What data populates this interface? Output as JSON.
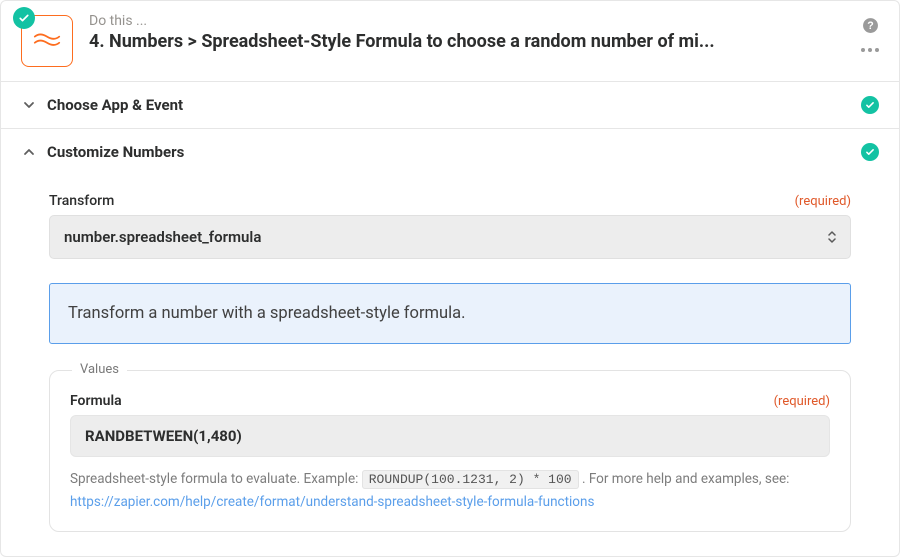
{
  "header": {
    "kicker": "Do this ...",
    "title": "4. Numbers > Spreadsheet-Style Formula to choose a random number of mi..."
  },
  "sections": {
    "choose": {
      "title": "Choose App & Event"
    },
    "customize": {
      "title": "Customize Numbers"
    }
  },
  "transform": {
    "label": "Transform",
    "required": "(required)",
    "value": "number.spreadsheet_formula"
  },
  "banner": {
    "text": "Transform a number with a spreadsheet-style formula."
  },
  "values": {
    "legend": "Values",
    "formula_label": "Formula",
    "formula_required": "(required)",
    "formula_value": "RANDBETWEEN(1,480)",
    "helper_prefix": "Spreadsheet-style formula to evaluate. Example: ",
    "helper_code": "ROUNDUP(100.1231, 2) * 100",
    "helper_suffix": ". For more help and examples, see:",
    "helper_link": "https://zapier.com/help/create/format/understand-spreadsheet-style-formula-functions"
  }
}
